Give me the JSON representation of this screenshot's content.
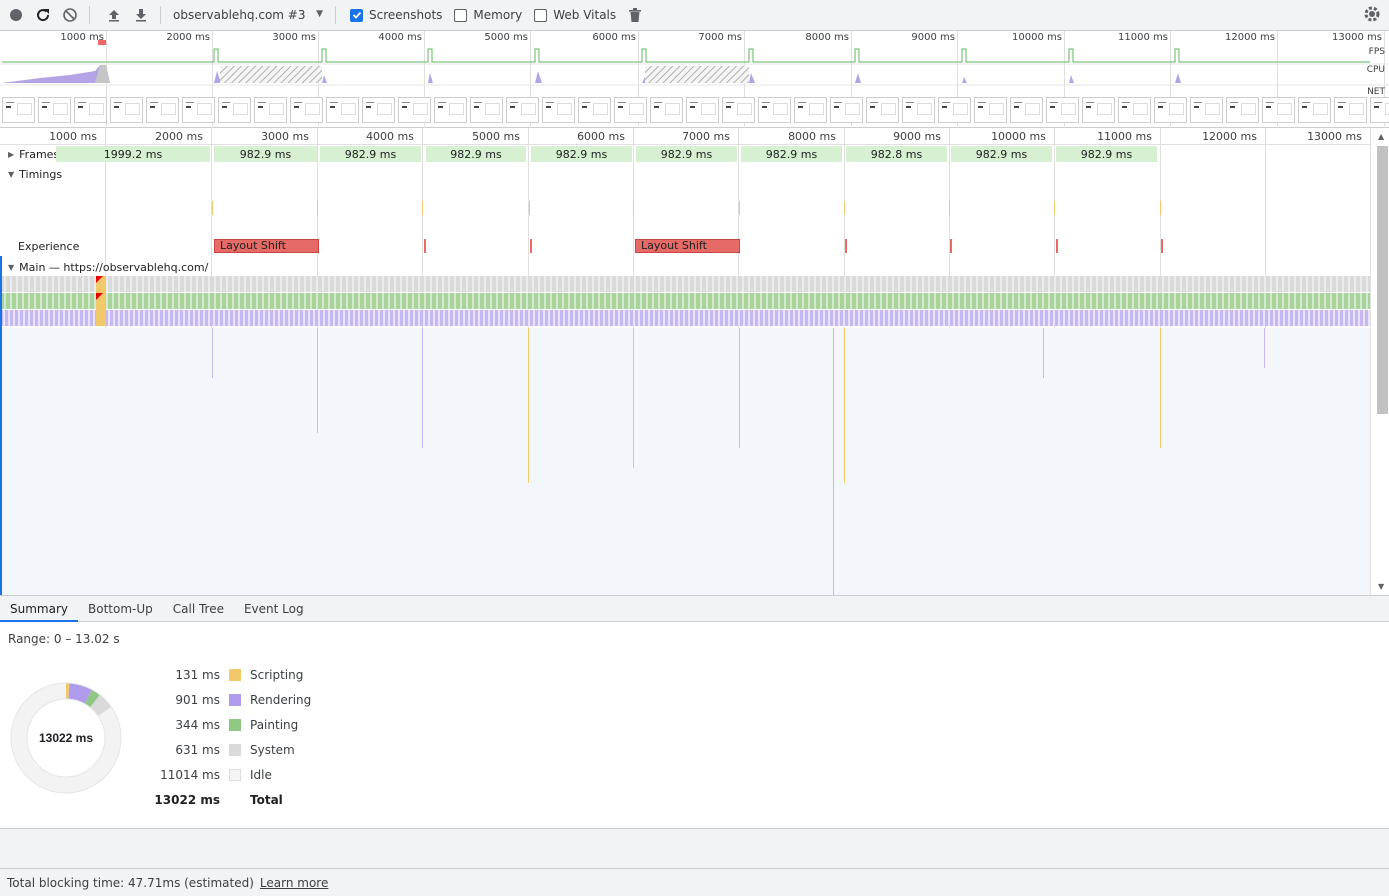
{
  "toolbar": {
    "record_icon": "record-icon",
    "reload_icon": "reload-icon",
    "clear_icon": "clear-icon",
    "upload_icon": "upload-icon",
    "download_icon": "download-icon",
    "profile_select": "observablehq.com #3",
    "screenshots_label": "Screenshots",
    "screenshots_checked": true,
    "memory_label": "Memory",
    "memory_checked": false,
    "webvitals_label": "Web Vitals",
    "webvitals_checked": false,
    "trash_icon": "trash-icon",
    "gear_icon": "gear-icon"
  },
  "overview": {
    "ticks": [
      "1000 ms",
      "2000 ms",
      "3000 ms",
      "4000 ms",
      "5000 ms",
      "6000 ms",
      "7000 ms",
      "8000 ms",
      "9000 ms",
      "10000 ms",
      "11000 ms",
      "12000 ms",
      "13000 ms"
    ],
    "fps_label": "FPS",
    "cpu_label": "CPU",
    "net_label": "NET"
  },
  "flamechart": {
    "ticks": [
      "1000 ms",
      "2000 ms",
      "3000 ms",
      "4000 ms",
      "5000 ms",
      "6000 ms",
      "7000 ms",
      "8000 ms",
      "9000 ms",
      "10000 ms",
      "11000 ms",
      "12000 ms",
      "13000 ms"
    ],
    "frames_label": "Frames",
    "frames": [
      "1999.2 ms",
      "982.9 ms",
      "982.9 ms",
      "982.9 ms",
      "982.9 ms",
      "982.9 ms",
      "982.9 ms",
      "982.8 ms",
      "982.9 ms",
      "982.9 ms",
      "982.9 ms"
    ],
    "timings_label": "Timings",
    "experience_label": "Experience",
    "layout_shift_1": "Layout Shift",
    "layout_shift_2": "Layout Shift",
    "main_label": "Main — https://observablehq.com/"
  },
  "tabs": [
    "Summary",
    "Bottom-Up",
    "Call Tree",
    "Event Log"
  ],
  "summary": {
    "range": "Range: 0 – 13.02 s",
    "donut_center": "13022 ms",
    "rows": [
      {
        "value": "131 ms",
        "name": "Scripting",
        "color": "#f2c96a"
      },
      {
        "value": "901 ms",
        "name": "Rendering",
        "color": "#af9bec"
      },
      {
        "value": "344 ms",
        "name": "Painting",
        "color": "#8fc882"
      },
      {
        "value": "631 ms",
        "name": "System",
        "color": "#dadada"
      },
      {
        "value": "11014 ms",
        "name": "Idle",
        "color": "#f5f5f5"
      }
    ],
    "total_value": "13022 ms",
    "total_label": "Total"
  },
  "status": {
    "text": "Total blocking time: 47.71ms (estimated)",
    "link": "Learn more"
  }
}
